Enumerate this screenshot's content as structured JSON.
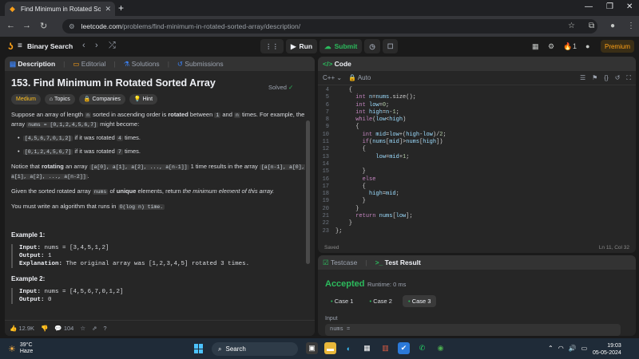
{
  "browser": {
    "tab_title": "Find Minimum in Rotated Sorte",
    "url_domain": "leetcode.com",
    "url_path": "/problems/find-minimum-in-rotated-sorted-array/description/"
  },
  "nav": {
    "problem_list": "Binary Search",
    "run": "Run",
    "submit": "Submit",
    "streak": "1",
    "premium": "Premium"
  },
  "left_tabs": [
    "Description",
    "Editorial",
    "Solutions",
    "Submissions"
  ],
  "problem": {
    "title": "153. Find Minimum in Rotated Sorted Array",
    "status": "Solved",
    "tags": [
      "Medium",
      "Topics",
      "Companies",
      "Hint"
    ],
    "p1_a": "Suppose an array of length",
    "p1_n": "n",
    "p1_b": "sorted in ascending order is",
    "p1_rot": "rotated",
    "p1_c": "between",
    "p1_one": "1",
    "p1_and": "and",
    "p1_n2": "n",
    "p1_d": "times. For example, the array",
    "p1_nums": "nums = [0,1,2,4,5,6,7]",
    "p1_e": "might become:",
    "bullets": [
      {
        "code": "[4,5,6,7,0,1,2]",
        "text": "if it was rotated",
        "k": "4",
        "end": "times."
      },
      {
        "code": "[0,1,2,4,5,6,7]",
        "text": "if it was rotated",
        "k": "7",
        "end": "times."
      }
    ],
    "p2_a": "Notice that",
    "p2_rot": "rotating",
    "p2_b": "an array",
    "p2_arr": "[a[0], a[1], a[2], ..., a[n-1]]",
    "p2_c": "1 time results in the array",
    "p2_arr2": "[a[n-1], a[0], a[1], a[2], ..., a[n-2]]",
    "p2_d": ".",
    "p3_a": "Given the sorted rotated array",
    "p3_nums": "nums",
    "p3_b": "of",
    "p3_unique": "unique",
    "p3_c": "elements, return",
    "p3_it": "the minimum element of this array.",
    "p4_a": "You must write an algorithm that runs in",
    "p4_code": "O(log n) time.",
    "ex1_h": "Example 1:",
    "ex1_in_l": "Input:",
    "ex1_in": "nums = [3,4,5,1,2]",
    "ex1_out_l": "Output:",
    "ex1_out": "1",
    "ex1_exp_l": "Explanation:",
    "ex1_exp": "The original array was [1,2,3,4,5] rotated 3 times.",
    "ex2_h": "Example 2:",
    "ex2_in_l": "Input:",
    "ex2_in": "nums = [4,5,6,7,0,1,2]",
    "ex2_out_l": "Output:",
    "ex2_out": "0"
  },
  "footer": {
    "likes": "12.9K",
    "comments": "104"
  },
  "code": {
    "tab": "Code",
    "lang": "C++",
    "mode": "Auto",
    "lines": [
      {
        "n": "4",
        "t": "    {"
      },
      {
        "n": "5",
        "t": "      int n=nums.size();"
      },
      {
        "n": "6",
        "t": "      int low=0;"
      },
      {
        "n": "7",
        "t": "      int high=n-1;"
      },
      {
        "n": "8",
        "t": "      while(low<high)"
      },
      {
        "n": "9",
        "t": "      {"
      },
      {
        "n": "10",
        "t": "        int mid=low+(high-low)/2;"
      },
      {
        "n": "11",
        "t": "        if(nums[mid]>nums[high])"
      },
      {
        "n": "12",
        "t": "        {"
      },
      {
        "n": "13",
        "t": "            low=mid+1;"
      },
      {
        "n": "14",
        "t": ""
      },
      {
        "n": "15",
        "t": "        }"
      },
      {
        "n": "16",
        "t": "        else"
      },
      {
        "n": "17",
        "t": "        {"
      },
      {
        "n": "18",
        "t": "          high=mid;"
      },
      {
        "n": "19",
        "t": "        }"
      },
      {
        "n": "20",
        "t": "      }"
      },
      {
        "n": "21",
        "t": "      return nums[low];"
      },
      {
        "n": "22",
        "t": "    }"
      },
      {
        "n": "23",
        "t": "};"
      }
    ],
    "saved": "Saved",
    "cursor": "Ln 11, Col 32"
  },
  "result": {
    "tabs": [
      "Testcase",
      "Test Result"
    ],
    "status": "Accepted",
    "runtime": "Runtime: 0 ms",
    "cases": [
      "Case 1",
      "Case 2",
      "Case 3"
    ],
    "input_label": "Input",
    "input_value": "nums ="
  },
  "taskbar": {
    "temp": "39°C",
    "weather": "Haze",
    "search": "Search",
    "time": "19:03",
    "date": "05-05-2024"
  },
  "colors": {
    "accent": "#ffa116",
    "success": "#2cbb5d",
    "medium": "#ffc01e"
  }
}
